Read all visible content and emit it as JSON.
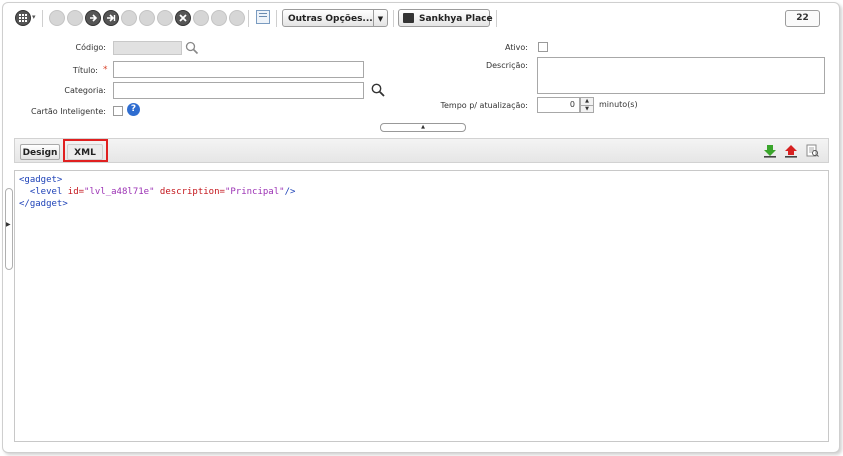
{
  "toolbar": {
    "icons": [
      "grid-menu-icon",
      "first-record-icon",
      "previous-record-icon",
      "next-record-icon",
      "last-record-icon",
      "add-icon",
      "remove-icon",
      "confirm-icon",
      "cancel-icon",
      "refresh-icon",
      "copy-icon",
      "edit-icon"
    ],
    "report_icon": "report-icon",
    "more_options_label": "Outras Opções...",
    "sankhya_place_label": "Sankhya Place",
    "counter": "22"
  },
  "form": {
    "codigo_label": "Código:",
    "titulo_label": "Título:",
    "required_mark": "*",
    "categoria_label": "Categoria:",
    "cartao_label": "Cartão Inteligente:",
    "ativo_label": "Ativo:",
    "descricao_label": "Descrição:",
    "tempo_label": "Tempo p/ atualização:",
    "tempo_value": "0",
    "tempo_unit": "minuto(s)",
    "help_symbol": "?"
  },
  "tabs": {
    "design_label": "Design",
    "xml_label": "XML",
    "selected": "XML"
  },
  "editor": {
    "lines": [
      "<gadget>",
      "  <level id=\"lvl_a48l71e\" description=\"Principal\"/>",
      "</gadget>"
    ],
    "line1_tag": "<gadget>",
    "line2_indent": "  ",
    "line2_open": "<level ",
    "line2_attr1": "id=",
    "line2_val1": "\"lvl_a48l71e\"",
    "line2_attr2": " description=",
    "line2_val2": "\"Principal\"",
    "line2_close": "/>",
    "line3_tag": "</gadget>"
  },
  "colors": {
    "tag": "#1f43b8",
    "attribute": "#c4161c",
    "value": "#9b31b4",
    "highlight": "#e02020",
    "download_arrow": "#3aa52b",
    "upload_arrow": "#d62020"
  }
}
